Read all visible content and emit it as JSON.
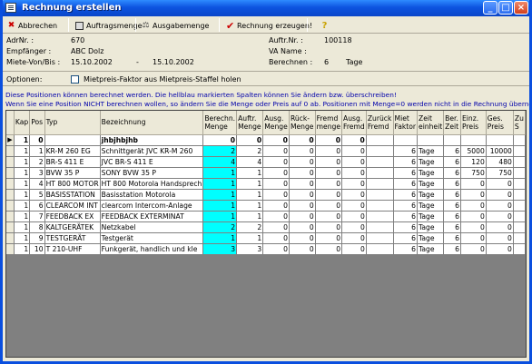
{
  "window": {
    "title": "Rechnung erstellen"
  },
  "toolbar": {
    "cancel": "Abbrechen",
    "order_qty": "Auftragsmenge",
    "out_qty": "Ausgabemenge",
    "create": "Rechnung erzeugen!",
    "help": "?"
  },
  "header": {
    "adr_label": "AdrNr. :",
    "adr_value": "670",
    "empf_label": "Empfänger :",
    "empf_value": "ABC Dolz",
    "miete_label": "Miete-Von/Bis :",
    "miete_von": "15.10.2002",
    "miete_sep": "-",
    "miete_bis": "15.10.2002",
    "auftr_label": "Auftr.Nr. :",
    "auftr_value": "100118",
    "va_label": "VA Name :",
    "va_value": "",
    "ber_label": "Berechnen :",
    "ber_value": "6",
    "ber_unit": "Tage"
  },
  "options": {
    "label": "Optionen:",
    "checkbox_label": "Mietpreis-Faktor aus Mietpreis-Staffel holen"
  },
  "info": {
    "line1": "Diese Positionen können berechnet werden. Die hellblau markierten Spalten können Sie ändern bzw. überschreiben!",
    "line2": "Wenn Sie eine Position NICHT berechnen wollen, so ändern Sie die Menge oder Preis auf 0 ab. Positionen mit Menge=0 werden nicht in die Rechnung übernommen!"
  },
  "grid": {
    "columns": [
      "Kap",
      "Pos",
      "Typ",
      "Bezeichnung",
      "Berechn. Menge",
      "Auftr. Menge",
      "Ausg. Menge",
      "Rück- Menge",
      "Fremd menge",
      "Ausg. Fremd",
      "Zurück Fremd",
      "Miet Faktor",
      "Zeit einheit",
      "Ber. Zeit",
      "Einz. Preis",
      "Ges. Preis",
      "Zu S"
    ],
    "rows": [
      [
        "1",
        "0",
        "",
        "jhbjhbjhb",
        "0",
        "0",
        "0",
        "0",
        "0",
        "0",
        "",
        "",
        "",
        "",
        "",
        "",
        ""
      ],
      [
        "1",
        "1",
        "KR-M 260 EG",
        "Schnittgerät JVC KR-M 260",
        "2",
        "2",
        "0",
        "0",
        "0",
        "0",
        "",
        "6",
        "Tage",
        "6",
        "5000",
        "10000",
        ""
      ],
      [
        "1",
        "2",
        "BR-S 411 E",
        "JVC BR-S 411 E",
        "4",
        "4",
        "0",
        "0",
        "0",
        "0",
        "",
        "6",
        "Tage",
        "6",
        "120",
        "480",
        ""
      ],
      [
        "1",
        "3",
        "BVW 35 P",
        "SONY BVW 35 P",
        "1",
        "1",
        "0",
        "0",
        "0",
        "0",
        "",
        "6",
        "Tage",
        "6",
        "750",
        "750",
        ""
      ],
      [
        "1",
        "4",
        "HT 800 MOTOR",
        "HT 800 Motorola Handsprech",
        "1",
        "1",
        "0",
        "0",
        "0",
        "0",
        "",
        "6",
        "Tage",
        "6",
        "0",
        "0",
        ""
      ],
      [
        "1",
        "5",
        "BASISSTATION",
        "Basisstation Motorola",
        "1",
        "1",
        "0",
        "0",
        "0",
        "0",
        "",
        "6",
        "Tage",
        "6",
        "0",
        "0",
        ""
      ],
      [
        "1",
        "6",
        "CLEARCOM INT",
        "clearcom Intercom-Anlage",
        "1",
        "1",
        "0",
        "0",
        "0",
        "0",
        "",
        "6",
        "Tage",
        "6",
        "0",
        "0",
        ""
      ],
      [
        "1",
        "7",
        "FEEDBACK EX",
        "FEEDBACK EXTERMINAT",
        "1",
        "1",
        "0",
        "0",
        "0",
        "0",
        "",
        "6",
        "Tage",
        "6",
        "0",
        "0",
        ""
      ],
      [
        "1",
        "8",
        "KALTGERÄTEK",
        "Netzkabel",
        "2",
        "2",
        "0",
        "0",
        "0",
        "0",
        "",
        "6",
        "Tage",
        "6",
        "0",
        "0",
        ""
      ],
      [
        "1",
        "9",
        "TESTGERÄT",
        "Testgerät",
        "1",
        "1",
        "0",
        "0",
        "0",
        "0",
        "",
        "6",
        "Tage",
        "6",
        "0",
        "0",
        ""
      ],
      [
        "1",
        "10",
        "T 210-UHF",
        "Funkgerät, handlich und kle",
        "3",
        "3",
        "0",
        "0",
        "0",
        "0",
        "",
        "6",
        "Tage",
        "6",
        "0",
        "0",
        ""
      ]
    ],
    "current_row_marker": "▶"
  }
}
